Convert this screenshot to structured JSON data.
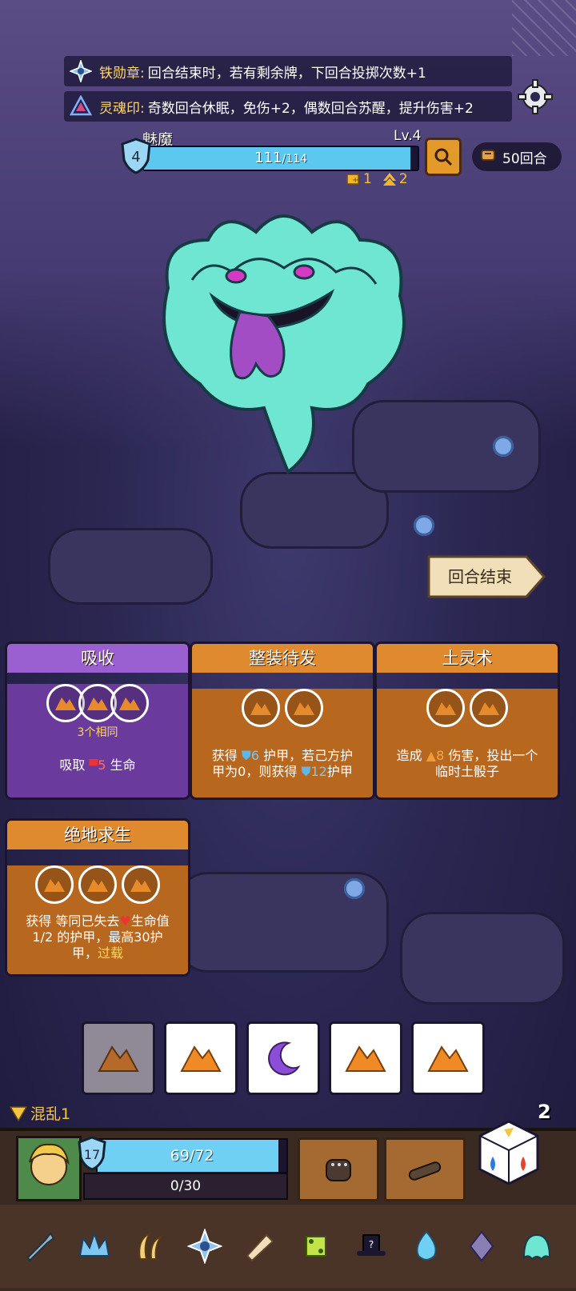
{
  "banners": [
    {
      "name": "铁勋章:",
      "text": "回合结束时，若有剩余牌，下回合投掷次数+1"
    },
    {
      "name": "灵魂印:",
      "text": "奇数回合休眠，免伤+2，偶数回合苏醒，提升伤害+2"
    }
  ],
  "enemy": {
    "name": "魅魔",
    "level": "Lv.4",
    "armor": "4",
    "hp_current": "111",
    "hp_max": "/114",
    "hp_fraction": 0.974,
    "buff_attack": "1",
    "buff_rank": "2"
  },
  "round": {
    "label": "50回合"
  },
  "end_turn": {
    "label": "回合结束"
  },
  "cards": [
    {
      "title": "吸收",
      "sub": "3个相同",
      "desc_parts": [
        "吸取 ",
        "5",
        " 生命"
      ]
    },
    {
      "title": "整装待发",
      "desc_parts": [
        "获得 ",
        "6",
        " 护甲，若己方护",
        "甲为0，则获得 ",
        "12",
        "护甲"
      ]
    },
    {
      "title": "土灵术",
      "desc_parts": [
        "造成 ",
        "8",
        " 伤害，投出一个",
        "临时土骰子"
      ]
    },
    {
      "title": "绝地求生",
      "desc_parts": [
        "获得 等同已失去",
        "生命值",
        "1/2 的护甲，最高30护",
        "甲，",
        "过载"
      ]
    }
  ],
  "status": {
    "label": "混乱1"
  },
  "dice_remaining": "2",
  "player": {
    "armor_level": "17",
    "hp_text": "69/72",
    "hp_fraction": 0.958,
    "armor_text": "0/30"
  },
  "colors": {
    "accent": "#ffd86b",
    "hp": "#5cc8f0",
    "orange": "#e08a30",
    "purple": "#9a5fd0"
  }
}
